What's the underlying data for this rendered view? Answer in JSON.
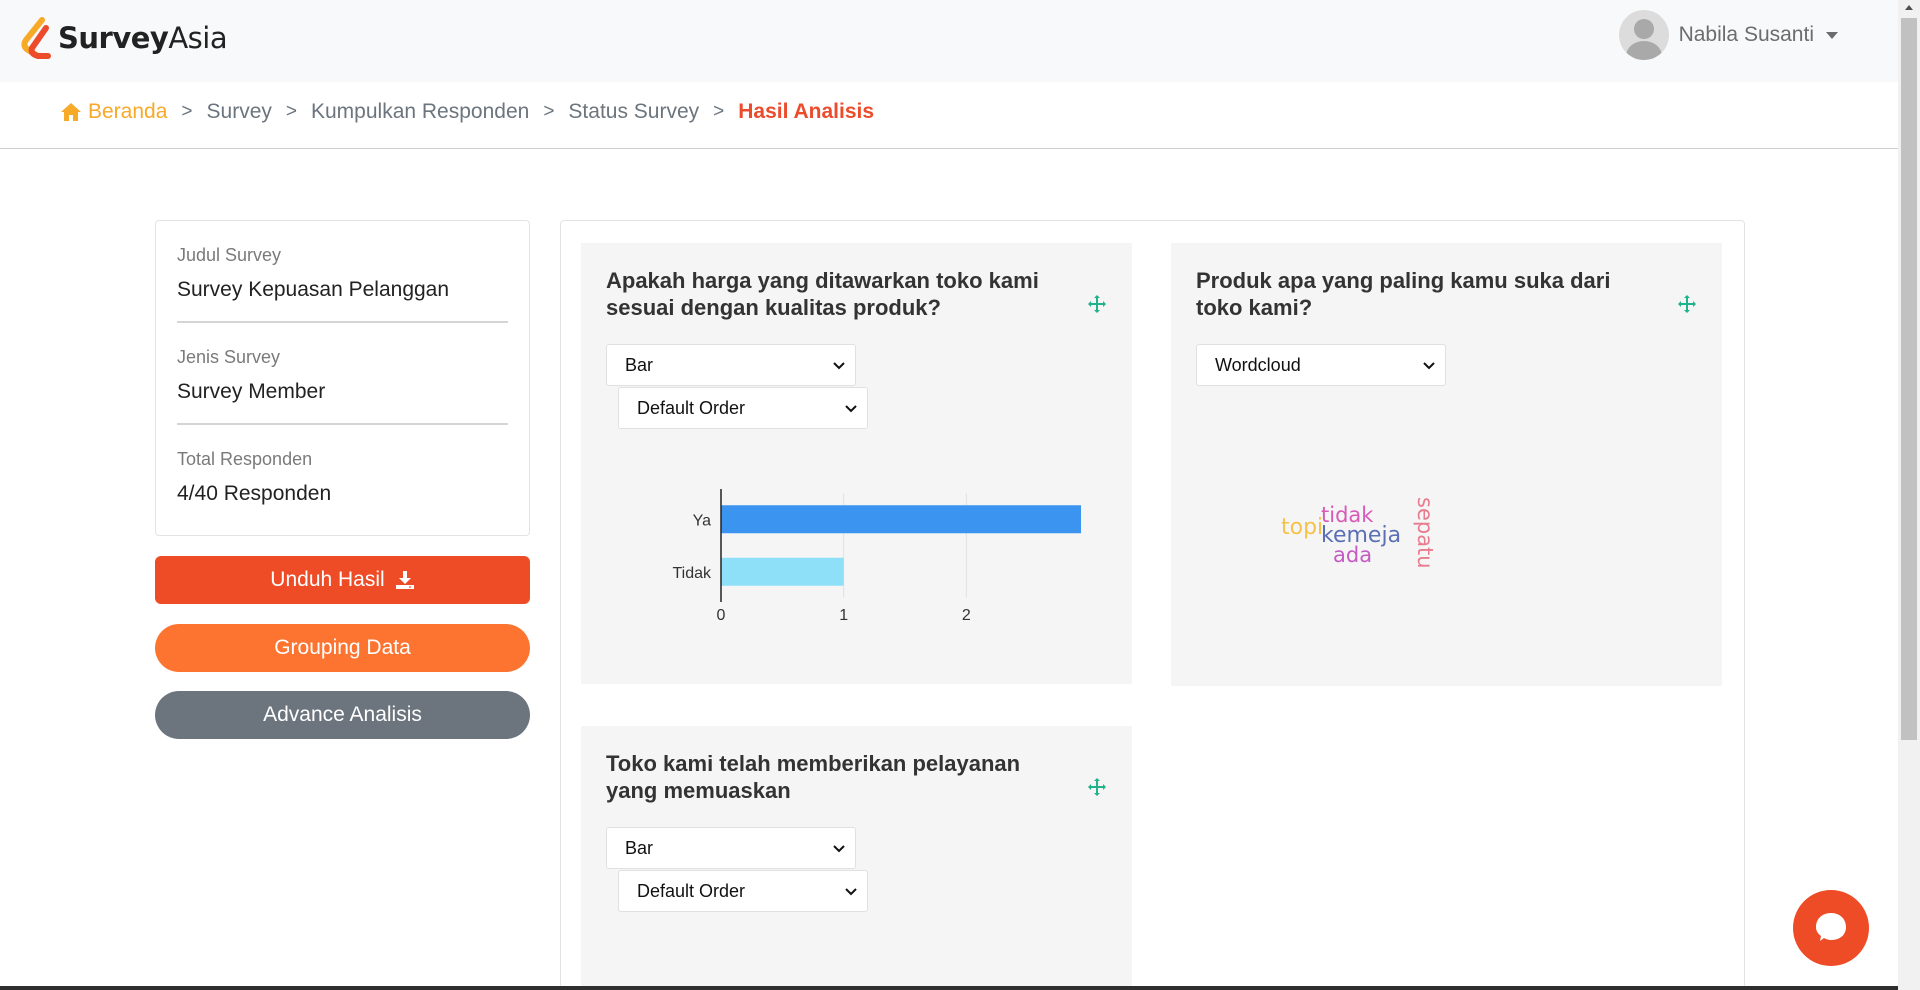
{
  "header": {
    "logo_bold": "Survey",
    "logo_light": "Asia",
    "user_name": "Nabila Susanti"
  },
  "breadcrumb": {
    "home": "Beranda",
    "items": [
      "Survey",
      "Kumpulkan Responden",
      "Status Survey"
    ],
    "active": "Hasil Analisis",
    "separator": ">"
  },
  "info": {
    "title_label": "Judul Survey",
    "title_value": "Survey Kepuasan Pelanggan",
    "type_label": "Jenis Survey",
    "type_value": "Survey Member",
    "total_label": "Total Responden",
    "total_value": "4/40 Responden"
  },
  "buttons": {
    "download": "Unduh Hasil",
    "grouping": "Grouping Data",
    "advance": "Advance Analisis"
  },
  "questions": [
    {
      "title": "Apakah harga yang ditawarkan toko kami sesuai dengan kualitas produk?",
      "chart_select": "Bar",
      "order_select": "Default Order"
    },
    {
      "title": "Produk apa yang paling kamu suka dari toko kami?",
      "chart_select": "Wordcloud"
    },
    {
      "title": "Toko kami telah memberikan pelayanan yang memuaskan",
      "chart_select": "Bar",
      "order_select": "Default Order"
    }
  ],
  "wordcloud": {
    "words": [
      {
        "text": "topi",
        "color": "#f5c24a"
      },
      {
        "text": "tidak",
        "color": "#d65bb8"
      },
      {
        "text": "kemeja",
        "color": "#5b6fb5"
      },
      {
        "text": "ada",
        "color": "#c45bc4"
      },
      {
        "text": "sepatu",
        "color": "#e87b8e"
      }
    ]
  },
  "chart_data": {
    "type": "bar",
    "orientation": "horizontal",
    "categories": [
      "Ya",
      "Tidak"
    ],
    "values": [
      3,
      1
    ],
    "colors": [
      "#3b95f0",
      "#8ee0f8"
    ],
    "xlim": [
      0,
      3
    ],
    "xticks": [
      "0",
      "1",
      "2",
      "3"
    ],
    "grid": true
  },
  "colors": {
    "accent_orange": "#f7a928",
    "active_red": "#ec4b2c",
    "download": "#ee4b27",
    "grouping": "#fd7431",
    "advance": "#6c757d",
    "move_icon": "#20b28a"
  }
}
